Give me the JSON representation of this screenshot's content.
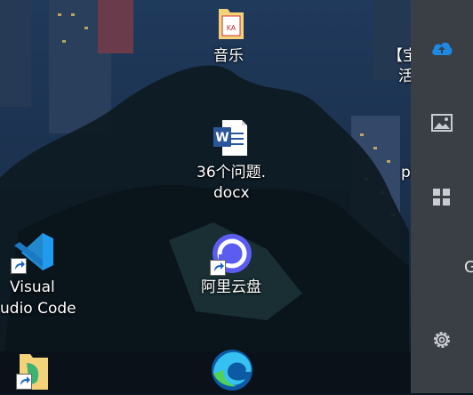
{
  "desktop": {
    "items": [
      {
        "label": "音乐"
      },
      {
        "label_line1": "36个问题.",
        "label_line2": "docx"
      },
      {
        "label_line1": "Visual",
        "label_line2": "udio Code"
      },
      {
        "label": "阿里云盘"
      }
    ],
    "edge_text_1": "【宝",
    "edge_text_2": "活",
    "edge_text_3": "p"
  },
  "sidebar": {
    "items": [
      {
        "icon": "cloud-upload-icon",
        "active": true
      },
      {
        "icon": "image-icon"
      },
      {
        "icon": "grid-apps-icon"
      },
      {
        "icon": "settings-gear-icon"
      }
    ],
    "partial_letter": "G",
    "colors": {
      "accent": "#1e88e5",
      "panel": "#3a3f45",
      "icon": "#c9cdd2"
    }
  }
}
